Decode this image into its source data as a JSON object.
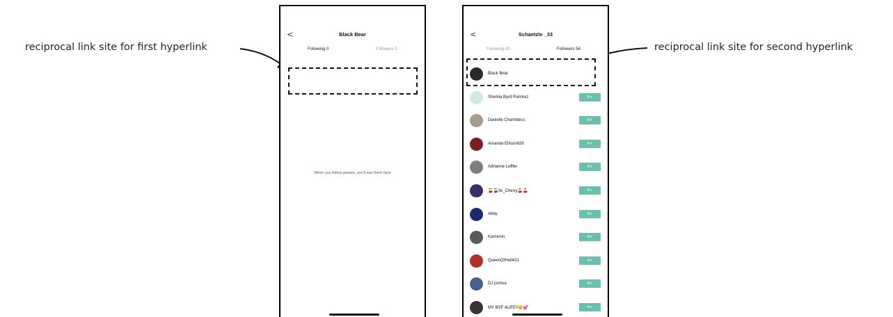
{
  "annotations": {
    "left": "reciprocal link site for first hyperlink",
    "right": "reciprocal link site for second hyperlink"
  },
  "left_screen": {
    "back_glyph": "<",
    "title": "Black Bear",
    "tabs": {
      "following": "Following 0",
      "followers": "Followers 0"
    },
    "empty_message": "When you follow people, you'll see them here"
  },
  "right_screen": {
    "back_glyph": "<",
    "title": "Schaetzle _33",
    "tabs": {
      "following": "Following 80",
      "followers": "Followers 54"
    },
    "follow_button_label": "R+",
    "users": [
      {
        "name": "Black Bear",
        "avatar_color": "#2a2a2a",
        "has_button": false
      },
      {
        "name": "Shemia Byrd Ramirez",
        "avatar_color": "#cfe9dd",
        "has_button": true
      },
      {
        "name": "Danielle Chambless",
        "avatar_color": "#a89c8c",
        "has_button": true
      },
      {
        "name": "Amanda Ellison626",
        "avatar_color": "#7a1f22",
        "has_button": true
      },
      {
        "name": "Adrianne Leffler",
        "avatar_color": "#7d7d7d",
        "has_button": true
      },
      {
        "name": "🍒🍒Its_Cherry🍒🍒",
        "avatar_color": "#3b2d6b",
        "has_button": true
      },
      {
        "name": "Abby",
        "avatar_color": "#1c2a6e",
        "has_button": true
      },
      {
        "name": "Kameron",
        "avatar_color": "#5a5a5a",
        "has_button": true
      },
      {
        "name": "QueenOfHell431",
        "avatar_color": "#b0302a",
        "has_button": true
      },
      {
        "name": "DJ joshua",
        "avatar_color": "#4a5f8a",
        "has_button": true
      },
      {
        "name": "MY BSF 4LIFE!!😊💕",
        "avatar_color": "#3a3330",
        "has_button": true
      }
    ]
  }
}
